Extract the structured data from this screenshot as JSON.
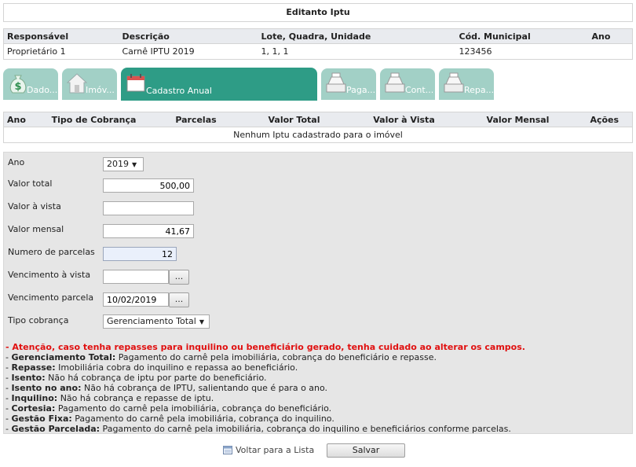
{
  "page": {
    "title": "Editanto Iptu"
  },
  "info": {
    "headers": [
      "Responsável",
      "Descrição",
      "Lote, Quadra, Unidade",
      "Cód. Municipal",
      "Ano"
    ],
    "row": [
      "Proprietário 1",
      "Carnê IPTU 2019",
      "1, 1, 1",
      "123456",
      ""
    ]
  },
  "tabs": [
    {
      "label": "Dado...",
      "icon": "money-bag-icon"
    },
    {
      "label": "Imóv...",
      "icon": "house-icon"
    },
    {
      "label": "Cadastro Anual",
      "icon": "calendar-icon",
      "active": true
    },
    {
      "label": "Paga...",
      "icon": "cash-register-icon"
    },
    {
      "label": "Cont...",
      "icon": "cash-register-icon"
    },
    {
      "label": "Repa...",
      "icon": "cash-register-icon"
    }
  ],
  "iptu_table": {
    "headers": [
      "Ano",
      "Tipo de Cobrança",
      "Parcelas",
      "Valor Total",
      "Valor à Vista",
      "Valor Mensal",
      "Ações"
    ],
    "empty_message": "Nenhum Iptu cadastrado para o imóvel"
  },
  "form": {
    "ano": {
      "label": "Ano",
      "value": "2019"
    },
    "valor_total": {
      "label": "Valor total",
      "value": "500,00"
    },
    "valor_vista": {
      "label": "Valor à vista",
      "value": ""
    },
    "valor_mensal": {
      "label": "Valor mensal",
      "value": "41,67"
    },
    "num_parcelas": {
      "label": "Numero de parcelas",
      "value": "12"
    },
    "venc_vista": {
      "label": "Vencimento à vista",
      "value": "",
      "button": "..."
    },
    "venc_parcela": {
      "label": "Vencimento parcela",
      "value": "10/02/2019",
      "button": "..."
    },
    "tipo_cobranca": {
      "label": "Tipo cobrança",
      "value": "Gerenciamento Total"
    }
  },
  "notes": {
    "warning": "- Atenção, caso tenha repasses para inquilino ou beneficiário gerado, tenha cuidado ao alterar os campos.",
    "items": [
      {
        "term": "Gerenciamento Total:",
        "text": " Pagamento do carnê pela imobiliária, cobrança do beneficiário e repasse."
      },
      {
        "term": "Repasse:",
        "text": " Imobiliária cobra do inquilino e repassa ao beneficiário."
      },
      {
        "term": "Isento:",
        "text": " Não há cobrança de iptu por parte do beneficiário."
      },
      {
        "term": "Isento no ano:",
        "text": " Não há cobrança de IPTU, salientando que é para o ano."
      },
      {
        "term": "Inquilino:",
        "text": " Não há cobrança e repasse de iptu."
      },
      {
        "term": "Cortesia:",
        "text": " Pagamento do carnê pela imobiliária, cobrança do beneficiário."
      },
      {
        "term": "Gestão Fixa:",
        "text": " Pagamento do carnê pela imobiliária, cobrança do inquilino."
      },
      {
        "term": "Gestão Parcelada:",
        "text": " Pagamento do carnê pela imobiliária, cobrança do inquilino e beneficiários conforme parcelas."
      }
    ]
  },
  "footer": {
    "back_label": "Voltar para a Lista",
    "save_label": "Salvar"
  },
  "colors": {
    "tab_active": "#2e9c86",
    "tab_inactive": "#a2d0c6",
    "warning": "#e01010",
    "header_bg": "#e9ebef",
    "panel_bg": "#e6e6e6"
  }
}
